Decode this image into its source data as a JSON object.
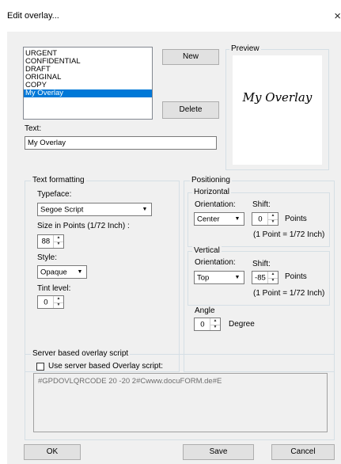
{
  "window": {
    "title": "Edit overlay...",
    "close_glyph": "×"
  },
  "overlay_list": {
    "items": [
      "URGENT",
      "CONFIDENTIAL",
      "DRAFT",
      "ORIGINAL",
      "COPY",
      "My Overlay"
    ],
    "selected_index": 5
  },
  "buttons": {
    "new_label": "New",
    "delete_label": "Delete",
    "ok_label": "OK",
    "save_label": "Save",
    "cancel_label": "Cancel"
  },
  "preview": {
    "group_label": "Preview",
    "text": "My Overlay"
  },
  "text_field": {
    "label": "Text:",
    "value": "My Overlay"
  },
  "text_formatting": {
    "group_label": "Text formatting",
    "typeface_label": "Typeface:",
    "typeface_value": "Segoe Script",
    "size_label": "Size in Points (1/72 Inch) :",
    "size_value": "88",
    "style_label": "Style:",
    "style_value": "Opaque",
    "tint_label": "Tint level:",
    "tint_value": "0"
  },
  "positioning": {
    "group_label": "Positioning",
    "horizontal": {
      "group_label": "Horizontal",
      "orientation_label": "Orientation:",
      "orientation_value": "Center",
      "shift_label": "Shift:",
      "shift_value": "0",
      "unit_label": "Points",
      "note": "(1 Point = 1/72 Inch)"
    },
    "vertical": {
      "group_label": "Vertical",
      "orientation_label": "Orientation:",
      "orientation_value": "Top",
      "shift_label": "Shift:",
      "shift_value": "-85",
      "unit_label": "Points",
      "note": "(1 Point = 1/72 Inch)"
    },
    "angle_label": "Angle",
    "angle_value": "0",
    "angle_unit": "Degree"
  },
  "server_script": {
    "group_label": "Server based overlay script",
    "checkbox_label": "Use server based Overlay script:",
    "checked": false,
    "script_text": "#GPDOVLQRCODE 20 -20 2#Cwww.docuFORM.de#E"
  },
  "icons": {
    "dropdown_arrow": "▼",
    "spin_up": "▲",
    "spin_down": "▼"
  }
}
